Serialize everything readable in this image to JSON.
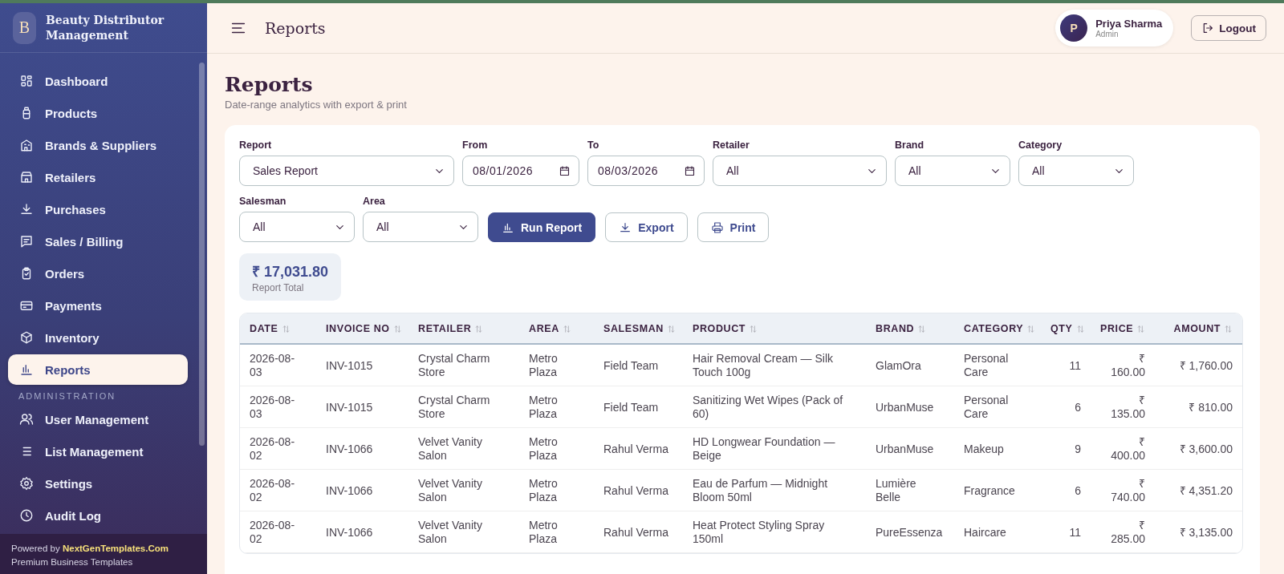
{
  "sidebar": {
    "logo_letter": "B",
    "title": "Beauty Distributor Management",
    "items": [
      {
        "label": "Dashboard",
        "selected": false
      },
      {
        "label": "Products",
        "selected": false
      },
      {
        "label": "Brands & Suppliers",
        "selected": false
      },
      {
        "label": "Retailers",
        "selected": false
      },
      {
        "label": "Purchases",
        "selected": false
      },
      {
        "label": "Sales / Billing",
        "selected": false
      },
      {
        "label": "Orders",
        "selected": false
      },
      {
        "label": "Payments",
        "selected": false
      },
      {
        "label": "Inventory",
        "selected": false
      },
      {
        "label": "Reports",
        "selected": true
      }
    ],
    "section_label": "ADMINISTRATION",
    "admin_items": [
      {
        "label": "User Management",
        "selected": false
      },
      {
        "label": "List Management",
        "selected": false
      },
      {
        "label": "Settings",
        "selected": false
      },
      {
        "label": "Audit Log",
        "selected": false
      }
    ],
    "footer": {
      "powered_by": "Powered by",
      "link": "NextGenTemplates.Com",
      "tagline": "Premium Business Templates"
    }
  },
  "header": {
    "title": "Reports",
    "user": {
      "initial": "P",
      "name": "Priya Sharma",
      "role": "Admin"
    },
    "logout": "Logout"
  },
  "page": {
    "title": "Reports",
    "subtitle": "Date-range analytics with export & print"
  },
  "filters": [
    {
      "label": "Report",
      "kind": "select",
      "value": "Sales Report"
    },
    {
      "label": "From",
      "kind": "date",
      "value": "08/01/2026"
    },
    {
      "label": "To",
      "kind": "date",
      "value": "08/03/2026"
    },
    {
      "label": "Retailer",
      "kind": "select",
      "value": "All"
    },
    {
      "label": "Brand",
      "kind": "select",
      "value": "All"
    },
    {
      "label": "Category",
      "kind": "select",
      "value": "All"
    },
    {
      "label": "Salesman",
      "kind": "select",
      "value": "All"
    },
    {
      "label": "Area",
      "kind": "select",
      "value": "All"
    }
  ],
  "actions": [
    {
      "label": "Run Report",
      "kind": "primary"
    },
    {
      "label": "Export",
      "kind": "outline"
    },
    {
      "label": "Print",
      "kind": "outline"
    }
  ],
  "total": {
    "value": "₹ 17,031.80",
    "label": "Report Total"
  },
  "table": {
    "columns": [
      {
        "label": "DATE"
      },
      {
        "label": "INVOICE NO"
      },
      {
        "label": "RETAILER"
      },
      {
        "label": "AREA"
      },
      {
        "label": "SALESMAN"
      },
      {
        "label": "PRODUCT"
      },
      {
        "label": "BRAND"
      },
      {
        "label": "CATEGORY"
      },
      {
        "label": "QTY"
      },
      {
        "label": "PRICE"
      },
      {
        "label": "AMOUNT"
      }
    ],
    "rows": [
      [
        "2026-08-03",
        "INV-1015",
        "Crystal Charm Store",
        "Metro Plaza",
        "Field Team",
        "Hair Removal Cream — Silk Touch 100g",
        "GlamOra",
        "Personal Care",
        "11",
        "₹ 160.00",
        "₹ 1,760.00"
      ],
      [
        "2026-08-03",
        "INV-1015",
        "Crystal Charm Store",
        "Metro Plaza",
        "Field Team",
        "Sanitizing Wet Wipes (Pack of 60)",
        "UrbanMuse",
        "Personal Care",
        "6",
        "₹ 135.00",
        "₹ 810.00"
      ],
      [
        "2026-08-02",
        "INV-1066",
        "Velvet Vanity Salon",
        "Metro Plaza",
        "Rahul Verma",
        "HD Longwear Foundation — Beige",
        "UrbanMuse",
        "Makeup",
        "9",
        "₹ 400.00",
        "₹ 3,600.00"
      ],
      [
        "2026-08-02",
        "INV-1066",
        "Velvet Vanity Salon",
        "Metro Plaza",
        "Rahul Verma",
        "Eau de Parfum — Midnight Bloom 50ml",
        "Lumière Belle",
        "Fragrance",
        "6",
        "₹ 740.00",
        "₹ 4,351.20"
      ],
      [
        "2026-08-02",
        "INV-1066",
        "Velvet Vanity Salon",
        "Metro Plaza",
        "Rahul Verma",
        "Heat Protect Styling Spray 150ml",
        "PureEssenza",
        "Haircare",
        "11",
        "₹ 285.00",
        "₹ 3,135.00"
      ]
    ]
  }
}
